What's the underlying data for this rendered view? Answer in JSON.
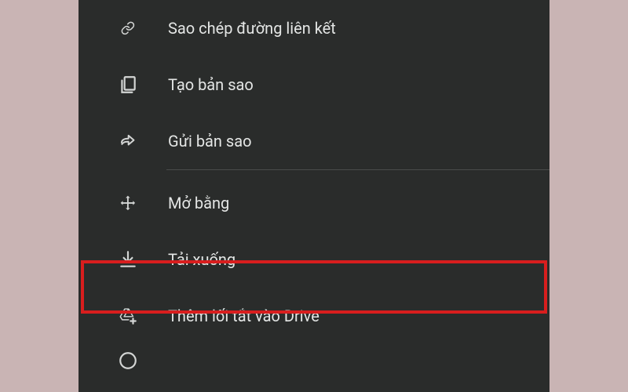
{
  "menu": {
    "copy_link": "Sao chép đường liên kết",
    "make_copy": "Tạo bản sao",
    "send_copy": "Gửi bản sao",
    "open_with": "Mở bằng",
    "download": "Tải xuống",
    "add_shortcut": "Thêm lối tắt vào Drive",
    "details_partial": ""
  }
}
